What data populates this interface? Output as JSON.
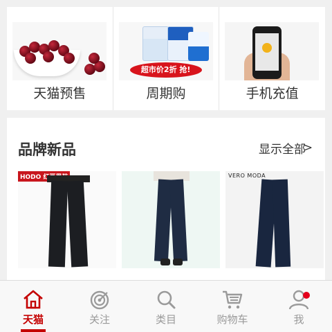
{
  "quick_entries": [
    {
      "label": "天猫预售",
      "image": "cherries-in-bowl"
    },
    {
      "label": "周期购",
      "image": "milk-cartons",
      "image_banner": "超市价2折 抢!"
    },
    {
      "label": "手机充值",
      "image": "hand-holding-phone"
    }
  ],
  "brand_section": {
    "title": "品牌新品",
    "more_label": "显示全部",
    "products": [
      {
        "brand_text": "HODO 红豆男装",
        "image": "black-trousers"
      },
      {
        "brand_text": "",
        "image": "dark-skinny-jeans"
      },
      {
        "brand_text": "VERO MODA",
        "image": "flared-jeans"
      }
    ]
  },
  "tabbar": {
    "accent_color": "#c40000",
    "items": [
      {
        "label": "天猫",
        "icon": "home-icon",
        "active": true
      },
      {
        "label": "关注",
        "icon": "target-icon",
        "active": false
      },
      {
        "label": "类目",
        "icon": "search-icon",
        "active": false
      },
      {
        "label": "购物车",
        "icon": "cart-icon",
        "active": false
      },
      {
        "label": "我",
        "icon": "user-icon",
        "active": false,
        "has_badge": true
      }
    ]
  }
}
